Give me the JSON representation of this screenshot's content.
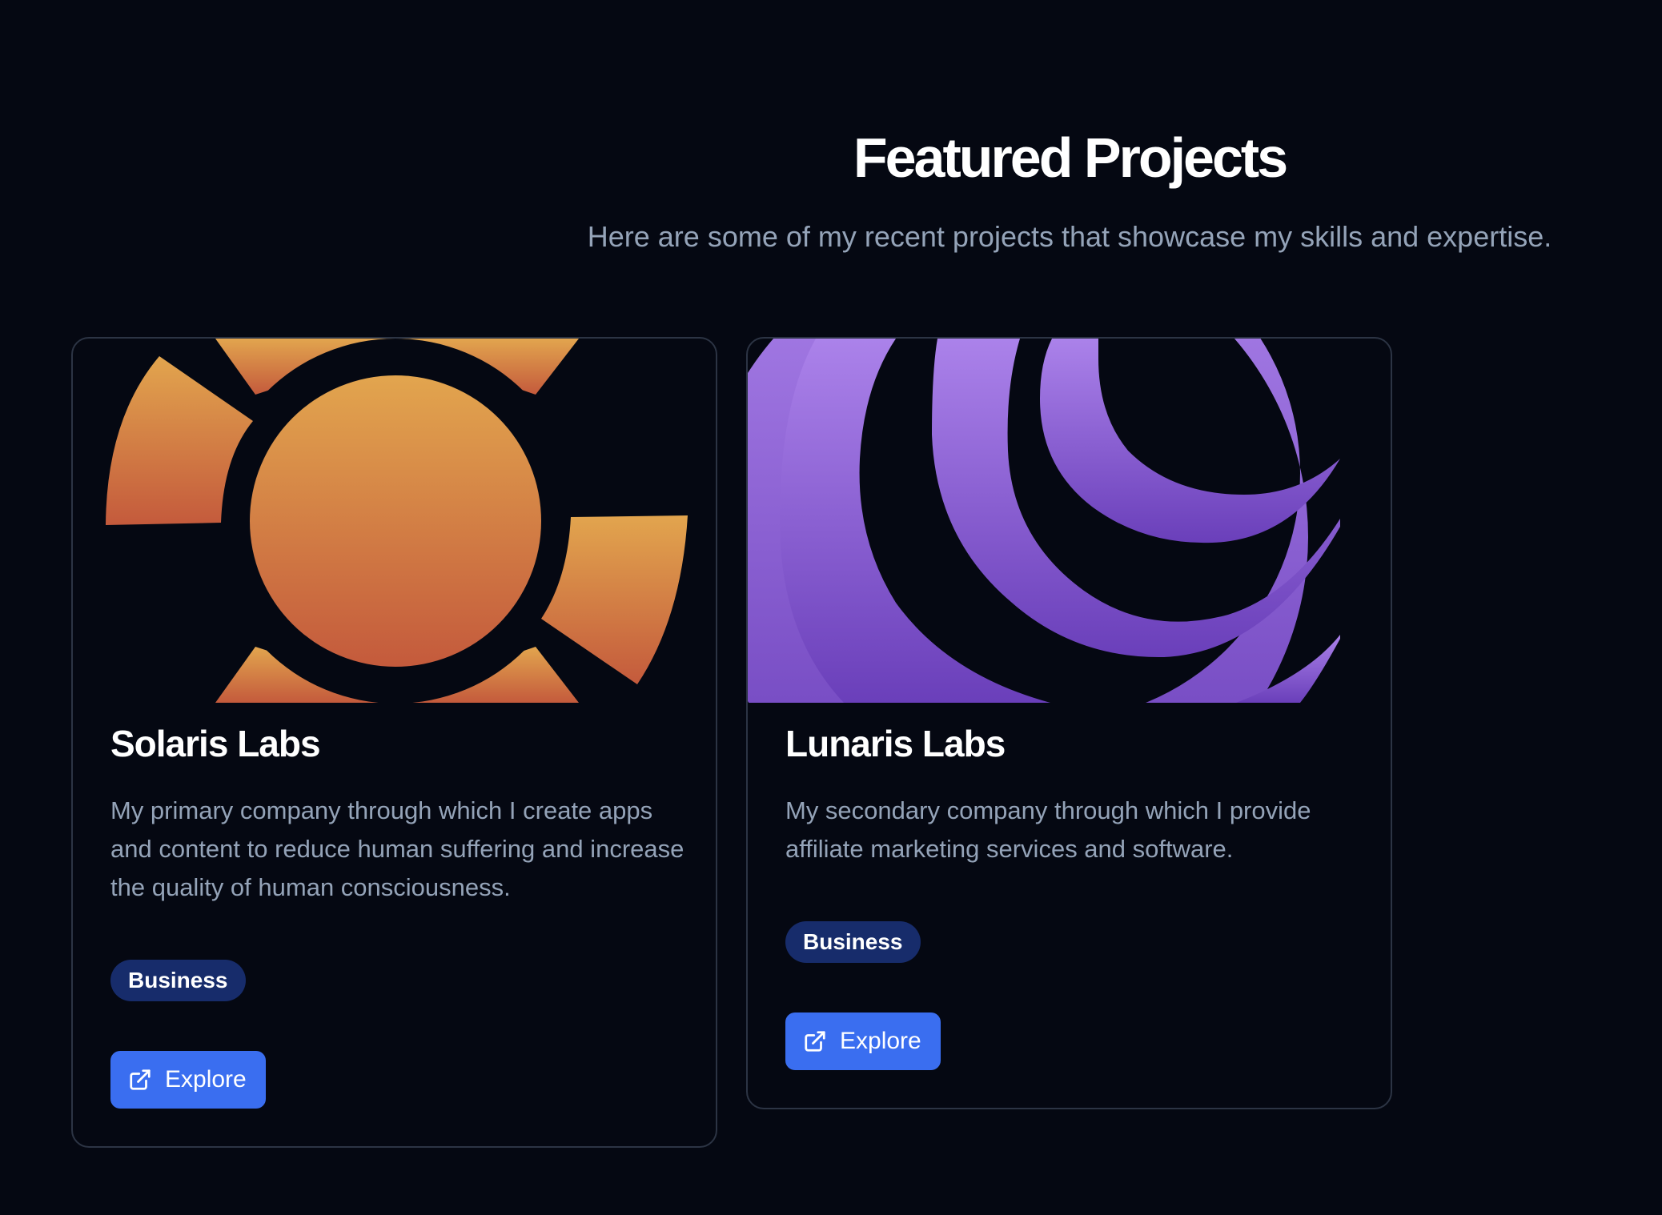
{
  "header": {
    "title": "Featured Projects",
    "subtitle": "Here are some of my recent projects that showcase my skills and expertise."
  },
  "projects": [
    {
      "name": "Solaris Labs",
      "description": "My primary company through which I create apps and content to reduce human suffering and increase the quality of human consciousness.",
      "tag": "Business",
      "button_label": "Explore",
      "logo_icon": "sun-logo-icon",
      "gradient": [
        "#e2a54e",
        "#c45a3c"
      ]
    },
    {
      "name": "Lunaris Labs",
      "description": "My secondary company through which I provide affiliate marketing services and software.",
      "tag": "Business",
      "button_label": "Explore",
      "logo_icon": "moon-logo-icon",
      "gradient": [
        "#ab82ea",
        "#6a3fba"
      ]
    }
  ],
  "colors": {
    "background": "#050812",
    "badge": "#172c6b",
    "button": "#3a6ef0",
    "muted_text": "#94a3b8"
  }
}
